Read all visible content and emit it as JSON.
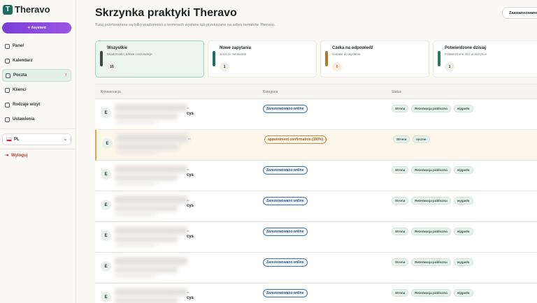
{
  "app": {
    "logo_letter": "T",
    "name": "Theravo"
  },
  "sidebar": {
    "assistant_label": "✦ Asystent",
    "items": [
      {
        "label": "Panel",
        "icon": "home-icon",
        "active": false,
        "badge": ""
      },
      {
        "label": "Kalendarz",
        "icon": "calendar-icon",
        "active": false,
        "badge": ""
      },
      {
        "label": "Poczta",
        "icon": "mail-icon",
        "active": true,
        "badge": "!"
      },
      {
        "label": "Klienci",
        "icon": "users-icon",
        "active": false,
        "badge": ""
      },
      {
        "label": "Rodzaje wizyt",
        "icon": "briefcase-icon",
        "active": false,
        "badge": ""
      },
      {
        "label": "Ustawienia",
        "icon": "gear-icon",
        "active": false,
        "badge": ""
      }
    ],
    "language": "PL",
    "logout": "Wyloguj"
  },
  "header": {
    "title": "Skrzynka praktyki Theravo",
    "subtitle": "Tutaj przetwarzane są tylko wiadomości o terminach wysłane lub przekazane na adres terminów Theravo.",
    "advanced_button": "Zaawansowane"
  },
  "cards": [
    {
      "title": "Wszystkie",
      "sub": "Wiadomości, szkice i rezerwacje",
      "count": "16",
      "color": "#3f4a47",
      "active": true
    },
    {
      "title": "Nowe zapytania",
      "sub": "Jeszcze nieotwarte",
      "count": "1",
      "color": "#1f6e63",
      "active": false
    },
    {
      "title": "Czeka na odpowiedź",
      "sub": "Gotowe do wysłania",
      "count": "0",
      "color": "#b07a2c",
      "active": false
    },
    {
      "title": "Potwierdzone dzisiaj",
      "sub": "Potwierdzone dziś w skrzynce",
      "count": "1",
      "color": "#2a7a55",
      "active": false
    }
  ],
  "table": {
    "headers": {
      "conversation": "Konwersacja",
      "category": "Kategoria",
      "status": "Status"
    },
    "rows": [
      {
        "avatar": "E",
        "tail_small": "n•",
        "tail": "cys",
        "category": "Zarezerwowano online",
        "warn": false,
        "tags": [
          "Strona",
          "Rezerwacja publiczna",
          "wygasło"
        ]
      },
      {
        "avatar": "E",
        "tail_small": "n•",
        "tail": "",
        "category": "appointment confirmation (100%)",
        "warn": true,
        "tags": [
          "Strona",
          "ręczne"
        ]
      },
      {
        "avatar": "E",
        "tail_small": "n•",
        "tail": "cys",
        "category": "Zarezerwowano online",
        "warn": false,
        "tags": [
          "Strona",
          "Rezerwacja publiczna",
          "wygasło"
        ]
      },
      {
        "avatar": "E",
        "tail_small": "n•",
        "tail": "cys",
        "category": "Zarezerwowano online",
        "warn": false,
        "tags": [
          "Strona",
          "Rezerwacja publiczna",
          "wygasło"
        ]
      },
      {
        "avatar": "E",
        "tail_small": "n•",
        "tail": "cys",
        "category": "Zarezerwowano online",
        "warn": false,
        "tags": [
          "Strona",
          "Rezerwacja publiczna",
          "wygasło"
        ]
      },
      {
        "avatar": "E",
        "tail_small": "",
        "tail": "",
        "category": "Zarezerwowano online",
        "warn": false,
        "tags": [
          "Strona",
          "Rezerwacja publiczna",
          "wygasło"
        ]
      },
      {
        "avatar": "E",
        "tail_small": "n•",
        "tail": "cys",
        "category": "Zarezerwowano online",
        "warn": false,
        "tags": [
          "Strona",
          "Rezerwacja publiczna",
          "wygasło"
        ]
      }
    ]
  }
}
